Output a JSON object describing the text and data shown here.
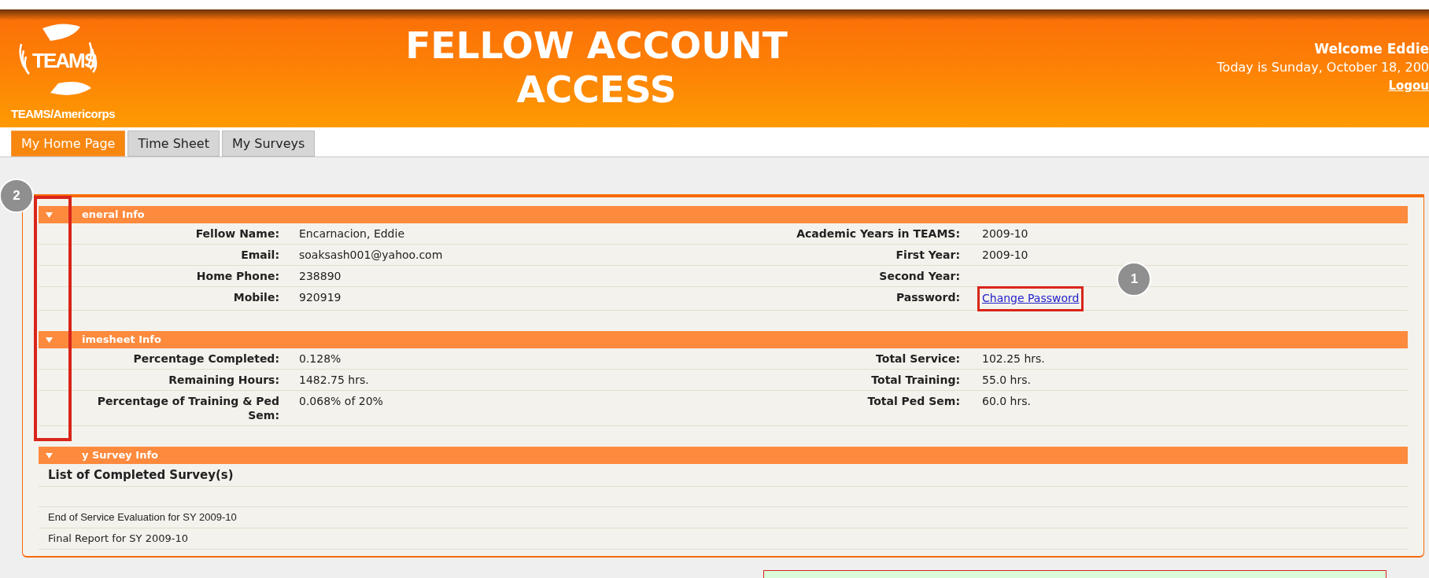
{
  "header": {
    "logo_mark": "TEAMS",
    "logo_caption": "TEAMS/Americorps",
    "title_lines": [
      "FELLOW ACCOUNT",
      "ACCESS"
    ],
    "welcome": "Welcome Eddie",
    "date": "Today is Sunday, October 18, 200",
    "logout": "Logou"
  },
  "tabs": [
    {
      "label": "My Home Page",
      "selected": true
    },
    {
      "label": "Time Sheet",
      "selected": false
    },
    {
      "label": "My Surveys",
      "selected": false
    }
  ],
  "sections": [
    {
      "title": "eneral Info",
      "expanded": true,
      "kind": "fields",
      "rows": [
        {
          "left": {
            "label": "Fellow Name:",
            "value": "Encarnacion, Eddie"
          },
          "right": {
            "label": "Academic Years in TEAMS:",
            "value": "2009-10",
            "kind": "text"
          }
        },
        {
          "left": {
            "label": "Email:",
            "value": "soaksash001@yahoo.com"
          },
          "right": {
            "label": "First Year:",
            "value": "2009-10",
            "kind": "text"
          }
        },
        {
          "left": {
            "label": "Home Phone:",
            "value": "238890"
          },
          "right": {
            "label": "Second Year:"
          }
        },
        {
          "left": {
            "label": "Mobile:",
            "value": "920919"
          },
          "right": {
            "label": "Password:",
            "value": "Change Password",
            "kind": "link"
          }
        }
      ]
    },
    {
      "title": "imesheet Info",
      "expanded": true,
      "kind": "fields",
      "rows": [
        {
          "left": {
            "label": "Percentage Completed:",
            "value": "0.128%"
          },
          "right": {
            "label": "Total Service:",
            "value": "102.25 hrs.",
            "kind": "text"
          }
        },
        {
          "left": {
            "label": "Remaining Hours:",
            "value": "1482.75 hrs."
          },
          "right": {
            "label": "Total Training:",
            "value": "55.0 hrs.",
            "kind": "text"
          }
        },
        {
          "left": {
            "label": "Percentage of Training & Ped Sem:",
            "value": "0.068% of 20%"
          },
          "right": {
            "label": "Total Ped Sem:",
            "value": "60.0 hrs.",
            "kind": "text"
          }
        }
      ]
    },
    {
      "title": "y Survey Info",
      "expanded": true,
      "kind": "list",
      "heading": "List of Completed Survey(s)",
      "items": [
        {
          "text": "End of Service Evaluation for SY 2009-10",
          "kind": "legacy"
        },
        {
          "text": "Final Report for SY 2009-10",
          "kind": "standard"
        }
      ]
    }
  ],
  "annotations": [
    {
      "number": "2"
    },
    {
      "number": "1"
    }
  ]
}
